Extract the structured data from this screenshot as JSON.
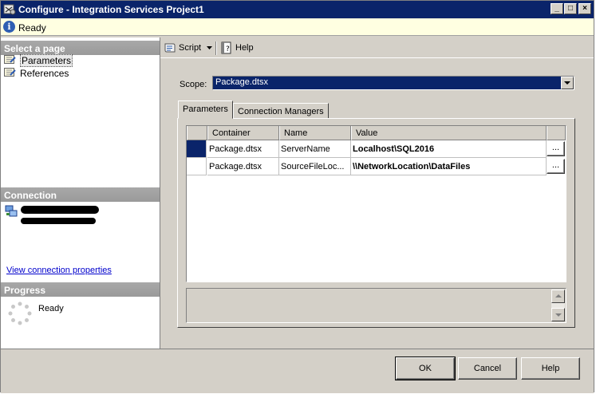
{
  "window": {
    "title": "Configure - Integration Services Project1",
    "controls": {
      "minimize": "_",
      "maximize": "□",
      "close": "×"
    }
  },
  "status": {
    "icon": "info-icon",
    "text": "Ready"
  },
  "left_pane": {
    "select_page_header": "Select a page",
    "pages": [
      {
        "label": "Parameters",
        "icon": "page-wrench-icon",
        "selected": true
      },
      {
        "label": "References",
        "icon": "page-wrench-icon",
        "selected": false
      }
    ],
    "connection_header": "Connection",
    "view_connection_link": "View connection properties",
    "progress_header": "Progress",
    "progress_status": "Ready"
  },
  "toolbar": {
    "script_label": "Script",
    "help_label": "Help"
  },
  "scope": {
    "label": "Scope:",
    "value": "Package.dtsx"
  },
  "tabs": [
    {
      "label": "Parameters",
      "active": true
    },
    {
      "label": "Connection Managers",
      "active": false
    }
  ],
  "grid": {
    "columns": [
      "Container",
      "Name",
      "Value"
    ],
    "rows": [
      {
        "container": "Package.dtsx",
        "name": "ServerName",
        "value": "Localhost\\SQL2016",
        "button": "..."
      },
      {
        "container": "Package.dtsx",
        "name": "SourceFileLoc...",
        "value": "\\\\NetworkLocation\\DataFiles",
        "button": "..."
      }
    ]
  },
  "buttons": {
    "ok": "OK",
    "cancel": "Cancel",
    "help": "Help"
  },
  "colors": {
    "title_bar": "#0a246a",
    "selection": "#0a246a",
    "link": "#0000cc",
    "status_bg": "#ffffe1"
  }
}
